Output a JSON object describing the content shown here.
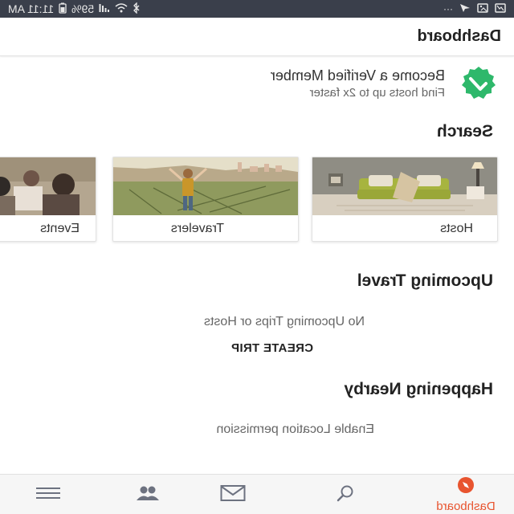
{
  "status_bar": {
    "time": "11:11 AM",
    "battery": "59%",
    "dots": "···"
  },
  "header": {
    "title": "Dashboard"
  },
  "verify_banner": {
    "title": "Become a Verified Member",
    "subtitle": "Find hosts up to 2x faster",
    "badge_color": "#2eb86b"
  },
  "search": {
    "heading": "Search",
    "cards": [
      {
        "label": "Hosts",
        "image": "living-room-photo"
      },
      {
        "label": "Travelers",
        "image": "traveler-vineyard-photo"
      },
      {
        "label": "Events",
        "image": "people-gathering-photo"
      }
    ]
  },
  "upcoming_travel": {
    "heading": "Upcoming Travel",
    "empty_message": "No Upcoming Trips or Hosts",
    "action_label": "CREATE TRIP"
  },
  "happening_nearby": {
    "heading": "Happening Nearby",
    "message": "Enable Location permission"
  },
  "bottom_nav": {
    "active_label": "Dashboard",
    "active_color": "#e8542f",
    "items": [
      {
        "name": "dashboard",
        "icon": "compass-icon"
      },
      {
        "name": "search",
        "icon": "search-icon"
      },
      {
        "name": "messages",
        "icon": "envelope-icon"
      },
      {
        "name": "people",
        "icon": "people-icon"
      },
      {
        "name": "menu",
        "icon": "menu-icon"
      }
    ]
  }
}
